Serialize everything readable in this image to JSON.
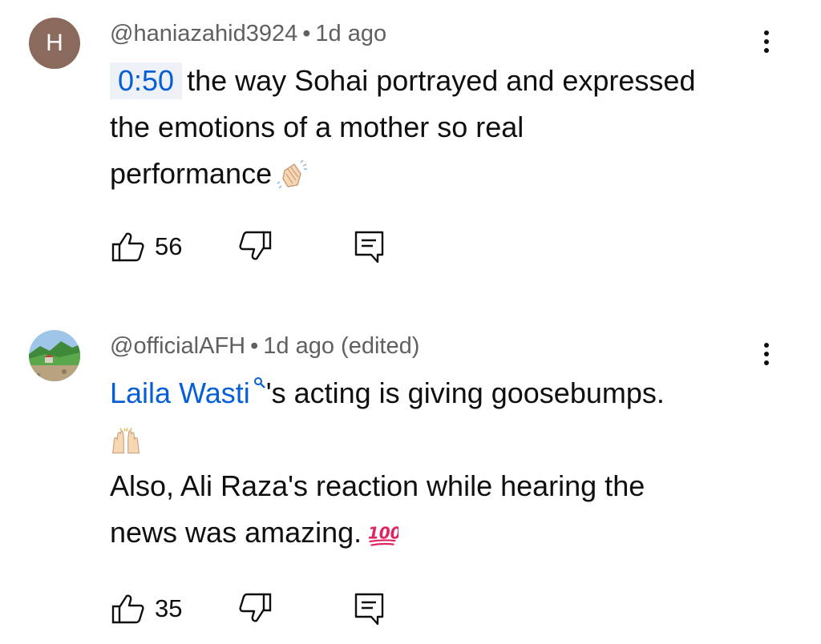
{
  "comments": [
    {
      "avatar_letter": "H",
      "author": "@haniazahid3924",
      "separator": "•",
      "time": "1d ago",
      "timestamp_link": "0:50",
      "text_line1": "the way Sohai portrayed and expressed",
      "text_line2": "the emotions of a mother so real",
      "text_line3": "performance",
      "likes": "56"
    },
    {
      "author": "@officialAFH",
      "separator": "•",
      "time": "1d ago (edited)",
      "mention": "Laila Wasti",
      "text_line1": "'s acting is giving goosebumps.",
      "text_line3": "Also, Ali Raza's reaction while hearing the",
      "text_line4": "news was amazing.",
      "likes": "35"
    }
  ],
  "icons": {
    "like": "thumbs-up-icon",
    "dislike": "thumbs-down-icon",
    "reply": "reply-icon",
    "menu": "more-vert-icon",
    "clap": "clapping-hands-emoji",
    "raised_hands": "raising-hands-emoji",
    "hundred": "hundred-points-emoji",
    "search": "search-icon"
  },
  "colors": {
    "link": "#065fd4",
    "meta": "#606060",
    "text": "#0f0f0f",
    "hundred_red": "#e0245e"
  }
}
